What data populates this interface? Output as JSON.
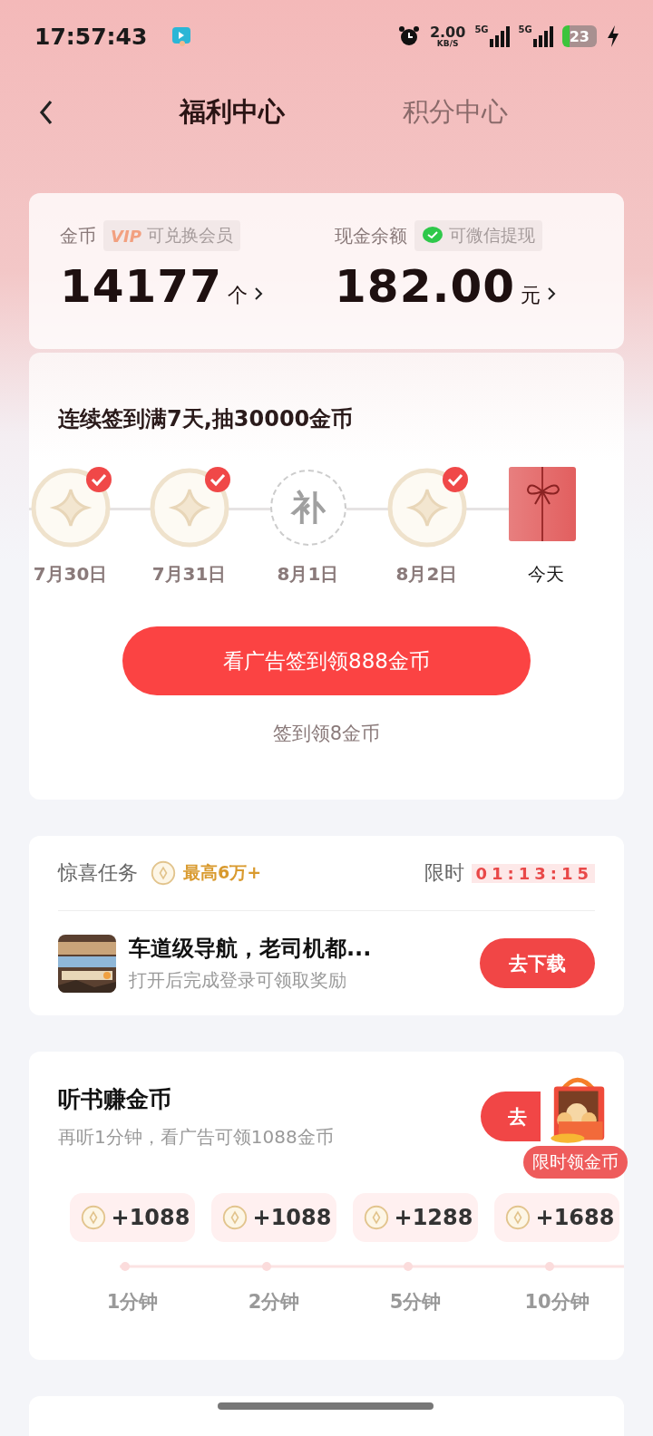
{
  "status_bar": {
    "time": "17:57:43",
    "speed": "2.00",
    "speed_unit": "KB/S",
    "network_1": "5G",
    "network_2": "5G",
    "battery": "23"
  },
  "nav": {
    "tabs": [
      {
        "label": "福利中心",
        "selected": true
      },
      {
        "label": "积分中心",
        "selected": false
      }
    ]
  },
  "balance": {
    "coins": {
      "label": "金币",
      "badge": "VIP",
      "badge_text": "可兑换会员",
      "value": "14177",
      "unit": "个"
    },
    "cash": {
      "label": "现金余额",
      "badge_text": "可微信提现",
      "value": "182.00",
      "unit": "元"
    }
  },
  "checkin": {
    "title": "连续签到满7天,抽30000金币",
    "days": [
      {
        "kind": "coin",
        "date": "7月30日",
        "checked": true,
        "selected": false
      },
      {
        "kind": "coin",
        "date": "7月31日",
        "checked": true,
        "selected": false
      },
      {
        "kind": "makeup",
        "mark": "补",
        "date": "8月1日",
        "checked": false,
        "selected": false
      },
      {
        "kind": "coin",
        "date": "8月2日",
        "checked": true,
        "selected": false
      },
      {
        "kind": "gift",
        "date": "今天",
        "checked": false,
        "selected": true
      }
    ],
    "button": "看广告签到领888金币",
    "link": "签到领8金币"
  },
  "surprise_task": {
    "title": "惊喜任务",
    "reward": "最高6万+",
    "limit_label": "限时",
    "countdown": "01:13:15",
    "task": {
      "title": "车道级导航，老司机都...",
      "subtitle": "打开后完成登录可领取奖励",
      "button": "去下载"
    }
  },
  "listen": {
    "title": "听书赚金币",
    "subtitle": "再听1分钟，看广告可领1088金币",
    "button": "去",
    "milestones": [
      {
        "reward": "+1088",
        "time": "1分钟"
      },
      {
        "reward": "+1088",
        "time": "2分钟"
      },
      {
        "reward": "+1288",
        "time": "5分钟"
      },
      {
        "reward": "+1688",
        "time": "10分钟"
      }
    ]
  },
  "floating_badge": "限时领金币"
}
